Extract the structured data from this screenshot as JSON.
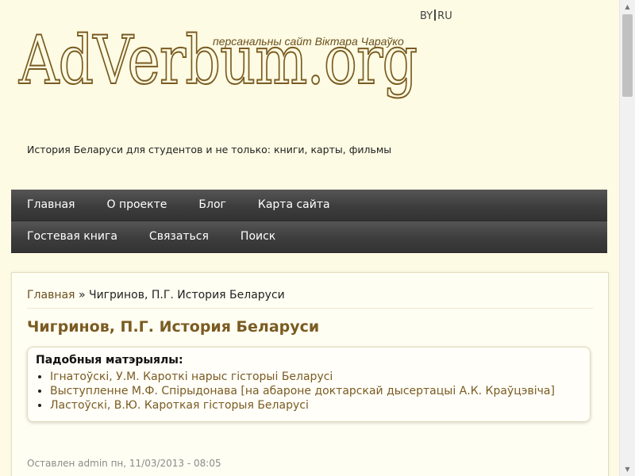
{
  "lang": {
    "by": "BY",
    "ru": "RU"
  },
  "header": {
    "logo_text": "AdVerbum.org",
    "personal_site": "персанальны сайт Віктара Чараўко",
    "slogan": "История Беларуси для студентов и не только: книги, карты, фильмы"
  },
  "nav": {
    "row1": [
      "Главная",
      "О проекте",
      "Блог",
      "Карта сайта"
    ],
    "row2": [
      "Гостевая книга",
      "Связаться",
      "Поиск"
    ]
  },
  "breadcrumb": {
    "home": "Главная",
    "sep": "»",
    "current": "Чигринов, П.Г. История Беларуси"
  },
  "page_title": "Чигринов, П.Г. История Беларуси",
  "related": {
    "heading": "Падобныя матэрыялы:",
    "items": [
      "Ігнатоўскі, У.М. Кароткі нарыс гісторыі Беларусі",
      "Выступленне М.Ф. Спірыдонава [на абароне доктарскай дысертацыі А.К. Краўцэвіча]",
      "Ластоўскі, В.Ю. Кароткая гісторыя Беларусі"
    ]
  },
  "meta": "Оставлен admin пн, 11/03/2013 - 08:05",
  "colors": {
    "background": "#fdfbe3",
    "accent": "#7a5b22",
    "nav": "#3d3d3d"
  },
  "icons": {
    "scroll_up": "arrow-up-icon",
    "scroll_down": "arrow-down-icon"
  }
}
